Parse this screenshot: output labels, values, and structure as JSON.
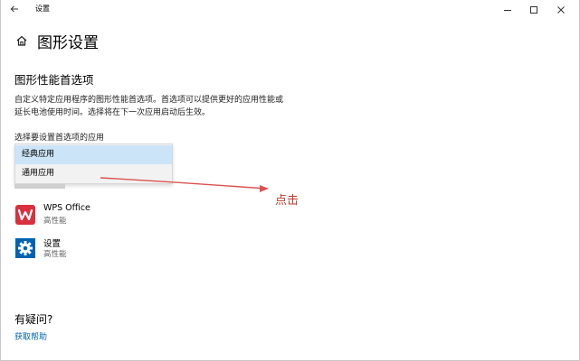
{
  "window": {
    "title": "设置",
    "controls": {
      "minimize_icon": "minimize-icon",
      "maximize_icon": "maximize-icon",
      "close_icon": "close-icon"
    }
  },
  "header": {
    "title": "图形设置"
  },
  "section": {
    "title": "图形性能首选项",
    "description": "自定义特定应用程序的图形性能首选项。首选项可以提供更好的应用性能或延长电池使用时间。选择将在下一次应用启动后生效。",
    "select_label": "选择要设置首选项的应用"
  },
  "dropdown": {
    "options": [
      "经典应用",
      "通用应用"
    ],
    "selected_index": 0
  },
  "annotation": {
    "text": "点击",
    "color": "#c0392b"
  },
  "apps": [
    {
      "name": "WPS Office",
      "preference": "高性能",
      "icon": "wps-office-icon",
      "icon_color": "#d9303e"
    },
    {
      "name": "设置",
      "preference": "高性能",
      "icon": "settings-gear-icon",
      "icon_color": "#0063b1"
    }
  ],
  "help": {
    "title": "有疑问?",
    "link": "获取帮助"
  },
  "colors": {
    "accent": "#0063b1",
    "selected_bg": "#cce4f7"
  }
}
